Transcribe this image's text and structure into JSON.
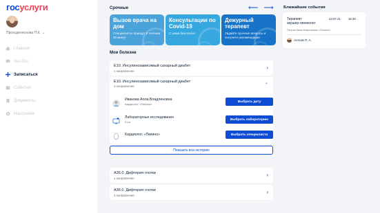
{
  "logo": {
    "part1": "гос",
    "part2": "услуги"
  },
  "user": {
    "name": "Проходеннонова П.К."
  },
  "nav": {
    "items": [
      {
        "label": "Главная",
        "icon": "home-icon"
      },
      {
        "label": "Чат-бот",
        "icon": "chat-icon"
      },
      {
        "label": "Записаться",
        "icon": "plus-icon"
      },
      {
        "label": "События",
        "icon": "calendar-icon"
      },
      {
        "label": "Документы",
        "icon": "document-icon"
      },
      {
        "label": "Настройки",
        "icon": "gear-icon"
      }
    ],
    "active_index": 2
  },
  "urgent": {
    "title": "Срочные",
    "tiles": [
      {
        "title": "Вызов врача на дом",
        "subtitle": "Специалисты приедут в течении 30 минут"
      },
      {
        "title": "Консультации по Covid-19",
        "subtitle": "С нами безопасно"
      },
      {
        "title": "Дежурный терапевт",
        "subtitle": "Задайте срочные вопросы и получите рекомендации"
      }
    ]
  },
  "diseases": {
    "title": "Мои болезни",
    "rows": [
      {
        "title": "E10. Инсулинозависимый сахарный диабет",
        "subtitle": "1 направление"
      },
      {
        "title": "E10. Инсулинозависимый сахарный диабет",
        "subtitle": "3 направления"
      }
    ],
    "referrals": [
      {
        "name": "Иванова Алла Владленовна",
        "desc": "Кардиолог, «Лапино»",
        "button": "Выбрать дату"
      },
      {
        "name": "Лабораторные исследования",
        "desc": "5 шт.",
        "button": "Выбрать лабораторию"
      },
      {
        "name": "Кардиолог, «Лапино»",
        "desc": "",
        "button": "Выбрать специалиста"
      }
    ],
    "history_button": "Показать всю историю",
    "more_rows": [
      {
        "title": "A36.0. Дифтерия глотки",
        "subtitle": "1 направление"
      },
      {
        "title": "A36.0. Дифтерия глотки",
        "subtitle": "3 направления"
      }
    ]
  },
  "events": {
    "title": "Ближайшие события",
    "items": [
      {
        "title_line1": "Терапевт",
        "title_line2": "акушер-гинеколог",
        "date": "23.07.21",
        "time": "16:30",
        "doctor": "Петров Иван Николаевич «Лапино»",
        "patient": "Антков П. А."
      }
    ]
  },
  "colors": {
    "accent": "#0d4cd3",
    "brand_red": "#ee3f58",
    "tile1": "#4aa3da",
    "tile2": "#37a7e0",
    "tile3": "#1673c7"
  }
}
